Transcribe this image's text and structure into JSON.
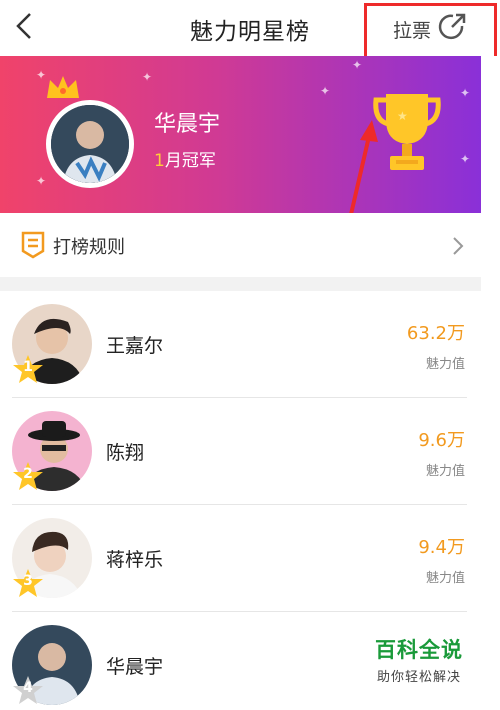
{
  "header": {
    "title": "魅力明星榜",
    "vote_label": "拉票"
  },
  "banner": {
    "champion_name": "华晨宇",
    "month_num": "1",
    "month_suffix": "月冠军"
  },
  "rules": {
    "label": "打榜规则"
  },
  "ranking": [
    {
      "rank": "1",
      "name": "王嘉尔",
      "score": "63.2万",
      "score_label": "魅力值"
    },
    {
      "rank": "2",
      "name": "陈翔",
      "score": "9.6万",
      "score_label": "魅力值"
    },
    {
      "rank": "3",
      "name": "蒋梓乐",
      "score": "9.4万",
      "score_label": "魅力值"
    },
    {
      "rank": "4",
      "name": "华晨宇",
      "score": "",
      "score_label": ""
    }
  ],
  "watermark": {
    "main": "百科全说",
    "sub": "助你轻松解决"
  },
  "colors": {
    "accent": "#f29a1f",
    "highlight": "#ee2a2a",
    "banner_start": "#f0436a",
    "banner_end": "#8a30d8"
  }
}
